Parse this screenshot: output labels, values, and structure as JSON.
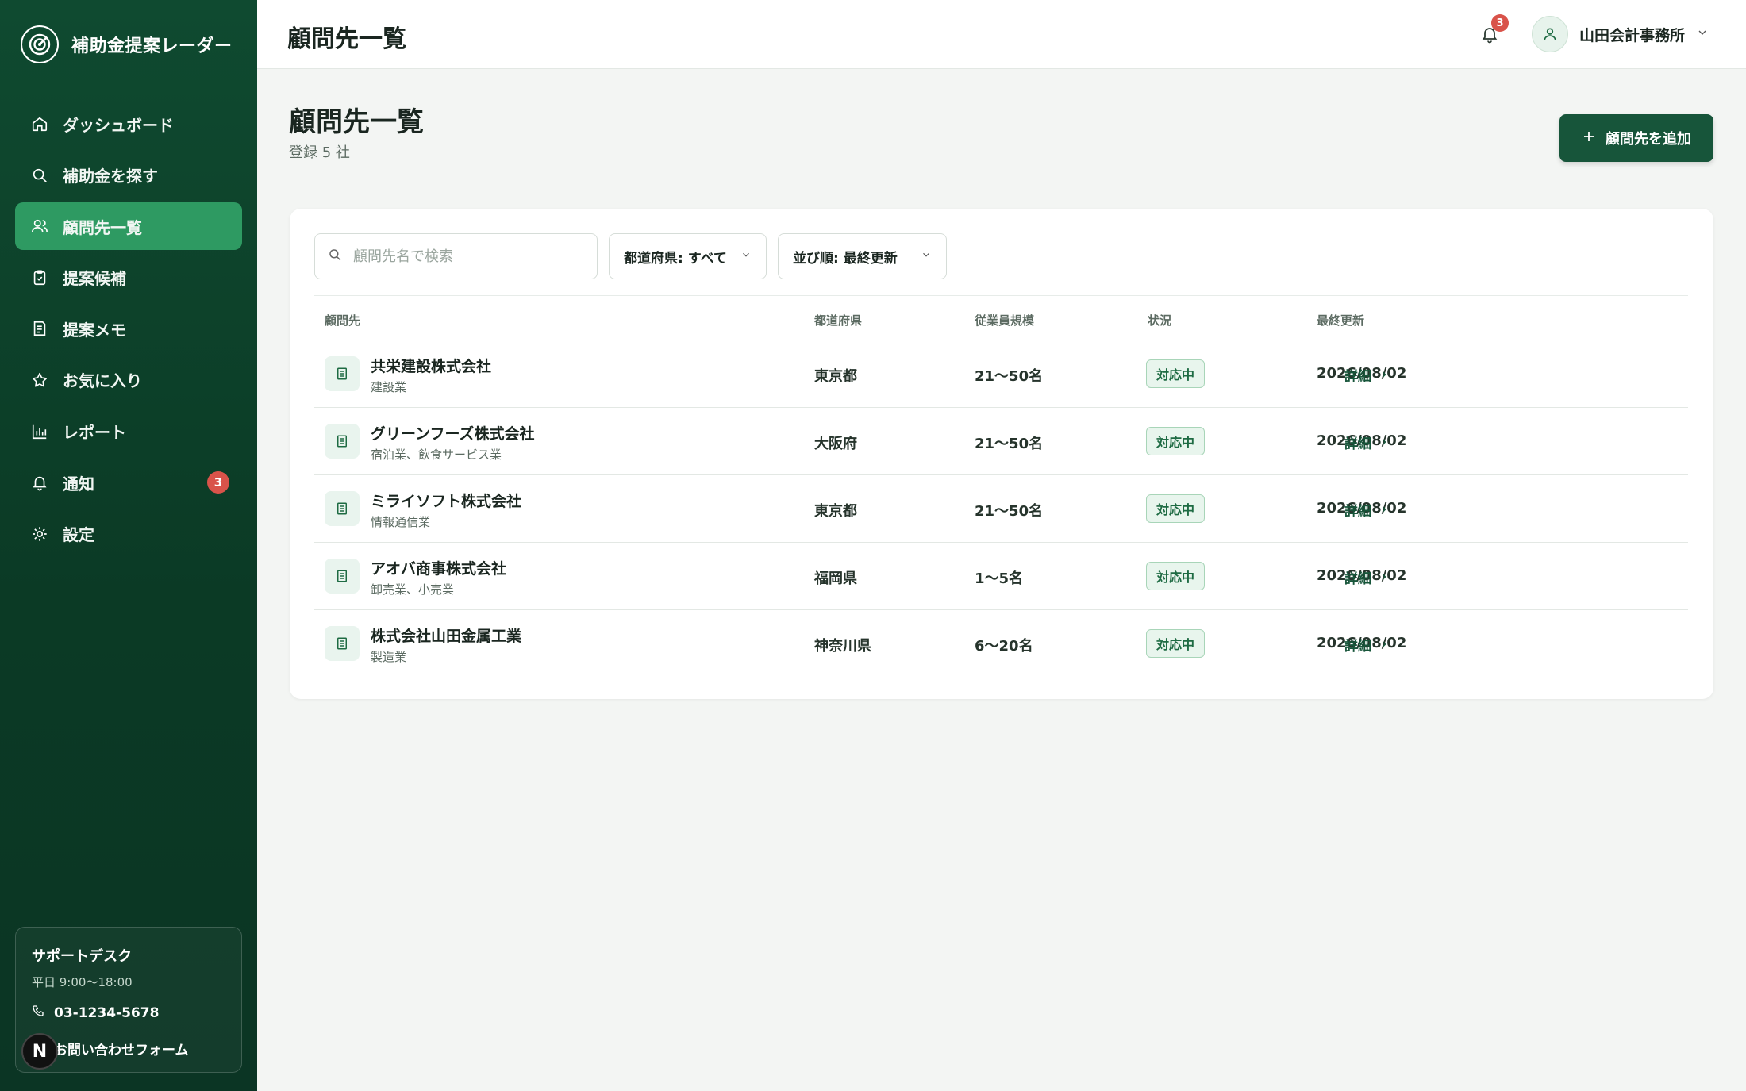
{
  "app": {
    "name": "補助金提案レーダー"
  },
  "sidebar": {
    "items": [
      {
        "label": "ダッシュボード",
        "icon": "home-icon"
      },
      {
        "label": "補助金を探す",
        "icon": "search-icon"
      },
      {
        "label": "顧問先一覧",
        "icon": "users-icon",
        "active": true
      },
      {
        "label": "提案候補",
        "icon": "clipboard-check-icon"
      },
      {
        "label": "提案メモ",
        "icon": "memo-icon"
      },
      {
        "label": "お気に入り",
        "icon": "star-icon"
      },
      {
        "label": "レポート",
        "icon": "bar-chart-icon"
      },
      {
        "label": "通知",
        "icon": "bell-icon",
        "badge": "3"
      },
      {
        "label": "設定",
        "icon": "gear-icon"
      }
    ],
    "support": {
      "title": "サポートデスク",
      "hours": "平日 9:00〜18:00",
      "phone": "03-1234-5678",
      "form": "お問い合わせフォーム"
    },
    "n_badge": "N"
  },
  "topbar": {
    "title": "顧問先一覧",
    "notification_count": "3",
    "user_name": "山田会計事務所"
  },
  "page": {
    "title": "顧問先一覧",
    "subtitle": "登録 5 社",
    "add_button": "顧問先を追加"
  },
  "filters": {
    "search_placeholder": "顧問先名で検索",
    "prefecture": "都道府県: すべて",
    "sort": "並び順: 最終更新"
  },
  "table": {
    "columns": [
      "顧問先",
      "都道府県",
      "従業員規模",
      "状況",
      "最終更新"
    ],
    "rows": [
      {
        "name": "共栄建設株式会社",
        "industry": "建設業",
        "prefecture": "東京都",
        "size": "21〜50名",
        "status": "対応中",
        "updated": "2026/08/02",
        "detail": "詳細"
      },
      {
        "name": "グリーンフーズ株式会社",
        "industry": "宿泊業、飲食サービス業",
        "prefecture": "大阪府",
        "size": "21〜50名",
        "status": "対応中",
        "updated": "2026/08/02",
        "detail": "詳細"
      },
      {
        "name": "ミライソフト株式会社",
        "industry": "情報通信業",
        "prefecture": "東京都",
        "size": "21〜50名",
        "status": "対応中",
        "updated": "2026/08/02",
        "detail": "詳細"
      },
      {
        "name": "アオバ商事株式会社",
        "industry": "卸売業、小売業",
        "prefecture": "福岡県",
        "size": "1〜5名",
        "status": "対応中",
        "updated": "2026/08/02",
        "detail": "詳細"
      },
      {
        "name": "株式会社山田金属工業",
        "industry": "製造業",
        "prefecture": "神奈川県",
        "size": "6〜20名",
        "status": "対応中",
        "updated": "2026/08/02",
        "detail": "詳細"
      }
    ]
  },
  "colors": {
    "sidebar": "#0f4a30",
    "active": "#2e9a62",
    "primary": "#17553a",
    "badge": "#d9534a"
  }
}
